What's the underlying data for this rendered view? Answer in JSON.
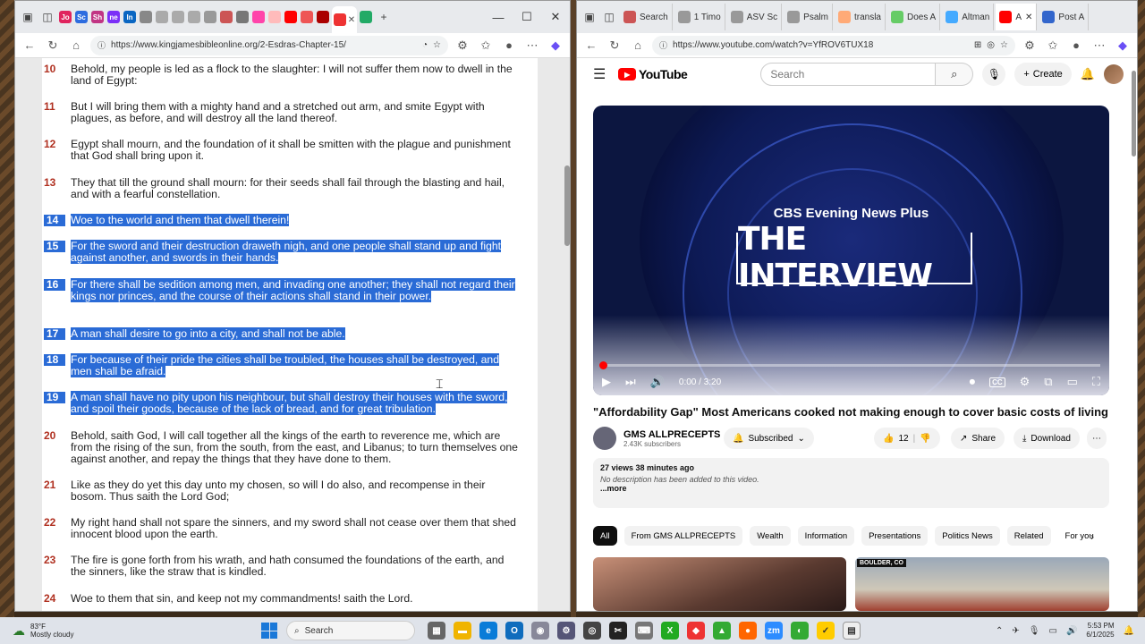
{
  "left_browser": {
    "url": "https://www.kingjamesbibleonline.org/2-Esdras-Chapter-15/",
    "tab_icons": [
      "Jo",
      "Sc",
      "Sh",
      "ne",
      "In"
    ],
    "verses": [
      {
        "num": "10",
        "text": "Behold, my people is led as a flock to the slaughter: I will not suffer them now to dwell in the land of Egypt:",
        "selected": false
      },
      {
        "num": "11",
        "text": "But I will bring them with a mighty hand and a stretched out arm, and smite Egypt with plagues, as before, and will destroy all the land thereof.",
        "selected": false
      },
      {
        "num": "12",
        "text": "Egypt shall mourn, and the foundation of it shall be smitten with the plague and punishment that God shall bring upon it.",
        "selected": false
      },
      {
        "num": "13",
        "text": "They that till the ground shall mourn: for their seeds shall fail through the blasting and hail, and with a fearful constellation.",
        "selected": false
      },
      {
        "num": "14",
        "text": "Woe to the world and them that dwell therein!",
        "selected": true
      },
      {
        "num": "15",
        "text": "For the sword and their destruction draweth nigh, and one people shall stand up and fight against another, and swords in their hands.",
        "selected": true
      },
      {
        "num": "16",
        "text": "For there shall be sedition among men, and invading one another; they shall not regard their kings nor princes, and the course of their actions shall stand in their power.",
        "selected": true
      },
      {
        "num": "17",
        "text": "A man shall desire to go into a city, and shall not be able.",
        "selected": true
      },
      {
        "num": "18",
        "text": "For because of their pride the cities shall be troubled, the houses shall be destroyed, and men shall be afraid.",
        "selected": true
      },
      {
        "num": "19",
        "text": "A man shall have no pity upon his neighbour, but shall destroy their houses with the sword, and spoil their goods, because of the lack of bread, and for great tribulation.",
        "selected": true
      },
      {
        "num": "20",
        "text": "Behold, saith God, I will call together all the kings of the earth to reverence me, which are from the rising of the sun, from the south, from the east, and Libanus; to turn themselves one against another, and repay the things that they have done to them.",
        "selected": false
      },
      {
        "num": "21",
        "text": "Like as they do yet this day unto my chosen, so will I do also, and recompense in their bosom. Thus saith the Lord God;",
        "selected": false
      },
      {
        "num": "22",
        "text": "My right hand shall not spare the sinners, and my sword shall not cease over them that shed innocent blood upon the earth.",
        "selected": false
      },
      {
        "num": "23",
        "text": "The fire is gone forth from his wrath, and hath consumed the foundations of the earth, and the sinners, like the straw that is kindled.",
        "selected": false
      },
      {
        "num": "24",
        "text": "Woe to them that sin, and keep not my commandments! saith the Lord.",
        "selected": false
      }
    ]
  },
  "right_browser": {
    "url": "https://www.youtube.com/watch?v=YfROV6TUX18",
    "tabs": [
      "Search",
      "1 Timo",
      "ASV Sc",
      "Psalm",
      "transla",
      "Does A",
      "Altman",
      "A",
      "Post A"
    ],
    "youtube": {
      "logo": "YouTube",
      "search_placeholder": "Search",
      "create_label": "Create",
      "player": {
        "brand": "CBS Evening News Plus",
        "show": "THE INTERVIEW",
        "time": "0:00 / 3:20",
        "cc": "CC"
      },
      "title": "\"Affordability Gap\" Most Americans cooked not making enough to cover basic costs of living",
      "channel": "GMS ALLPRECEPTS",
      "subscribers": "2.43K subscribers",
      "subscribed_label": "Subscribed",
      "likes": "12",
      "share_label": "Share",
      "download_label": "Download",
      "views_time": "27 views  38 minutes ago",
      "description": "No description has been added to this video.",
      "more": "...more",
      "chips": [
        "All",
        "From GMS ALLPRECEPTS",
        "Wealth",
        "Information",
        "Presentations",
        "Politics News",
        "Related",
        "For you"
      ],
      "thumb2_tag": "BOULDER, CO"
    }
  },
  "taskbar": {
    "temp": "83°F",
    "weather": "Mostly cloudy",
    "search_label": "Search",
    "time": "5:53 PM",
    "date": "6/1/2025"
  }
}
